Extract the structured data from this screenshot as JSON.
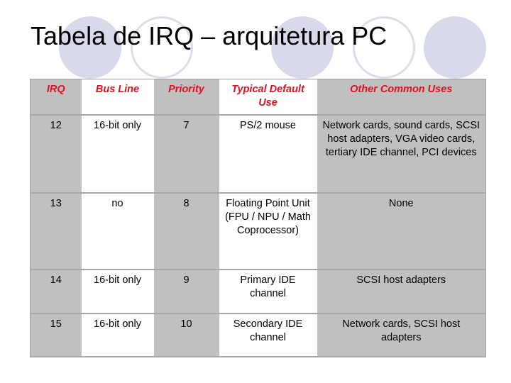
{
  "slide": {
    "title": "Tabela de IRQ – arquitetura PC"
  },
  "colors": {
    "header_text": "#e01020",
    "gray_column": "#c0c0c0",
    "circle": "#d9d9ec"
  },
  "table": {
    "headers": [
      "IRQ",
      "Bus Line",
      "Priority",
      "Typical Default Use",
      "Other Common Uses"
    ],
    "rows": [
      [
        "12",
        "16-bit only",
        "7",
        "PS/2 mouse",
        "Network cards, sound cards, SCSI host adapters, VGA video cards, tertiary IDE channel, PCI devices"
      ],
      [
        "13",
        "no",
        "8",
        "Floating Point Unit (FPU / NPU / Math Coprocessor)",
        "None"
      ],
      [
        "14",
        "16-bit only",
        "9",
        "Primary IDE channel",
        "SCSI host adapters"
      ],
      [
        "15",
        "16-bit only",
        "10",
        "Secondary IDE channel",
        "Network cards, SCSI host adapters"
      ]
    ]
  }
}
